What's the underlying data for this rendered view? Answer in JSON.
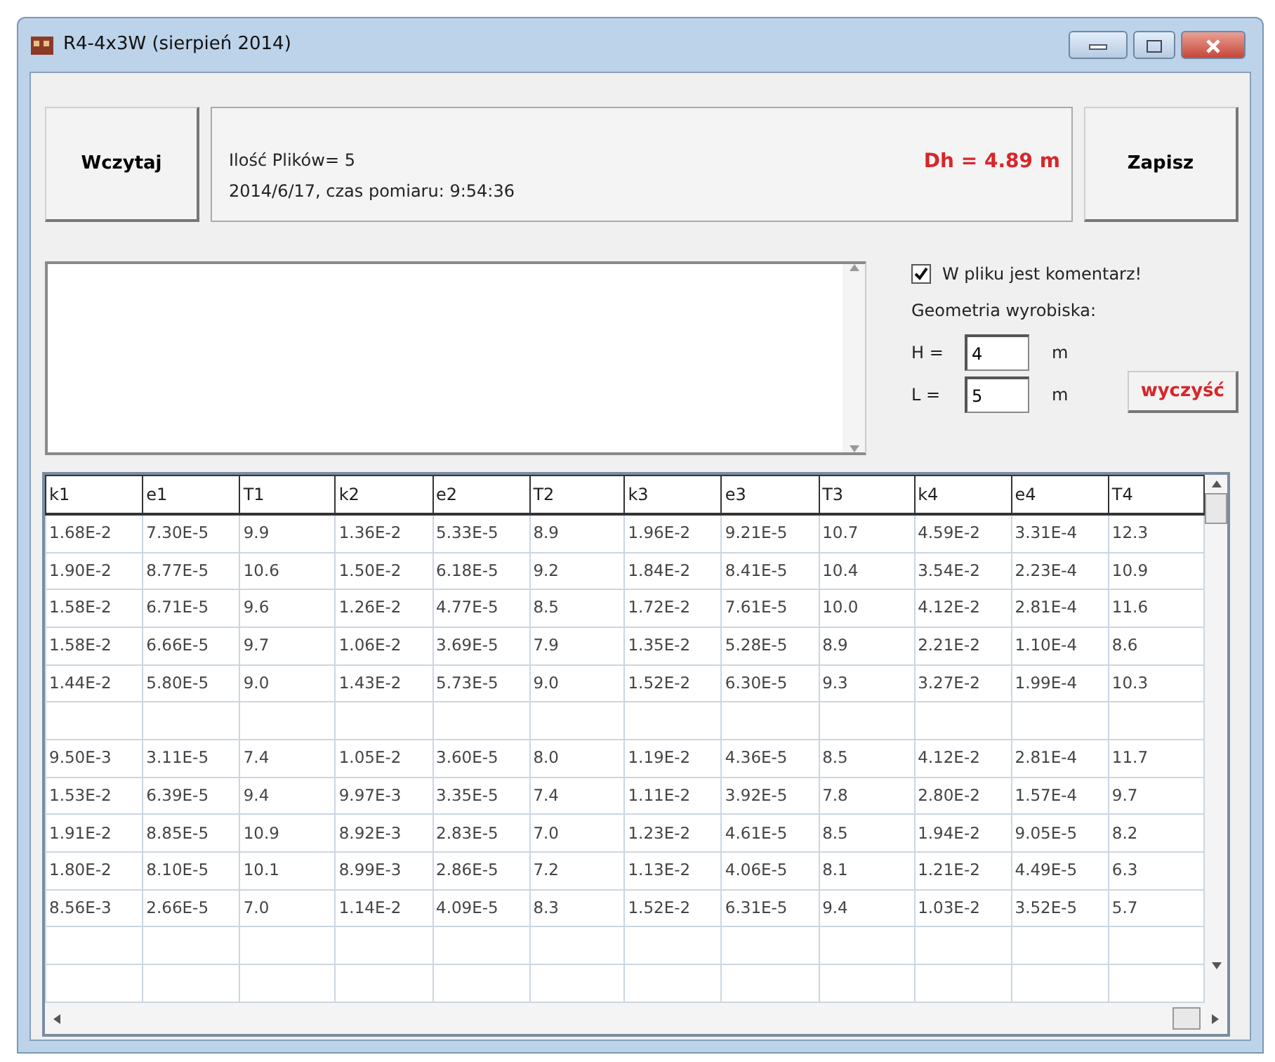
{
  "window": {
    "title": "R4-4x3W (sierpień 2014)"
  },
  "load_button": "Wczytaj",
  "info": {
    "files": "Ilość Plików= 5",
    "date": "2014/6/17, czas pomiaru: 9:54:36",
    "dh": "Dh = 4.89 m"
  },
  "save_button": "Zapisz",
  "comment_checkbox": {
    "label": "W pliku jest komentarz!",
    "checked": true
  },
  "geometry": {
    "title": "Geometria wyrobiska:",
    "fields": [
      {
        "label": "H =",
        "value": "4",
        "unit": "m"
      },
      {
        "label": "L =",
        "value": "5",
        "unit": "m"
      }
    ]
  },
  "clear_button": "wyczyść",
  "table": {
    "columns": [
      "k1",
      "e1",
      "T1",
      "k2",
      "e2",
      "T2",
      "k3",
      "e3",
      "T3",
      "k4",
      "e4",
      "T4"
    ],
    "rows": [
      {
        "kind": "data",
        "cells": [
          "1.68E-2",
          "7.30E-5",
          "9.9",
          "1.36E-2",
          "5.33E-5",
          "8.9",
          "1.96E-2",
          "9.21E-5",
          "10.7",
          "4.59E-2",
          "3.31E-4",
          "12.3"
        ]
      },
      {
        "kind": "data",
        "cells": [
          "1.90E-2",
          "8.77E-5",
          "10.6",
          "1.50E-2",
          "6.18E-5",
          "9.2",
          "1.84E-2",
          "8.41E-5",
          "10.4",
          "3.54E-2",
          "2.23E-4",
          "10.9"
        ]
      },
      {
        "kind": "data",
        "cells": [
          "1.58E-2",
          "6.71E-5",
          "9.6",
          "1.26E-2",
          "4.77E-5",
          "8.5",
          "1.72E-2",
          "7.61E-5",
          "10.0",
          "4.12E-2",
          "2.81E-4",
          "11.6"
        ]
      },
      {
        "kind": "data",
        "cells": [
          "1.58E-2",
          "6.66E-5",
          "9.7",
          "1.06E-2",
          "3.69E-5",
          "7.9",
          "1.35E-2",
          "5.28E-5",
          "8.9",
          "2.21E-2",
          "1.10E-4",
          "8.6"
        ]
      },
      {
        "kind": "data",
        "cells": [
          "1.44E-2",
          "5.80E-5",
          "9.0",
          "1.43E-2",
          "5.73E-5",
          "9.0",
          "1.52E-2",
          "6.30E-5",
          "9.3",
          "3.27E-2",
          "1.99E-4",
          "10.3"
        ]
      },
      {
        "kind": "blank"
      },
      {
        "kind": "data",
        "cells": [
          "9.50E-3",
          "3.11E-5",
          "7.4",
          "1.05E-2",
          "3.60E-5",
          "8.0",
          "1.19E-2",
          "4.36E-5",
          "8.5",
          "4.12E-2",
          "2.81E-4",
          "11.7"
        ]
      },
      {
        "kind": "data",
        "cells": [
          "1.53E-2",
          "6.39E-5",
          "9.4",
          "9.97E-3",
          "3.35E-5",
          "7.4",
          "1.11E-2",
          "3.92E-5",
          "7.8",
          "2.80E-2",
          "1.57E-4",
          "9.7"
        ]
      },
      {
        "kind": "data",
        "cells": [
          "1.91E-2",
          "8.85E-5",
          "10.9",
          "8.92E-3",
          "2.83E-5",
          "7.0",
          "1.23E-2",
          "4.61E-5",
          "8.5",
          "1.94E-2",
          "9.05E-5",
          "8.2"
        ]
      },
      {
        "kind": "data",
        "cells": [
          "1.80E-2",
          "8.10E-5",
          "10.1",
          "8.99E-3",
          "2.86E-5",
          "7.2",
          "1.13E-2",
          "4.06E-5",
          "8.1",
          "1.21E-2",
          "4.49E-5",
          "6.3"
        ]
      },
      {
        "kind": "data",
        "cells": [
          "8.56E-3",
          "2.66E-5",
          "7.0",
          "1.14E-2",
          "4.09E-5",
          "8.3",
          "1.52E-2",
          "6.31E-5",
          "9.4",
          "1.03E-2",
          "3.52E-5",
          "5.7"
        ]
      },
      {
        "kind": "blank"
      },
      {
        "kind": "blank"
      }
    ]
  }
}
